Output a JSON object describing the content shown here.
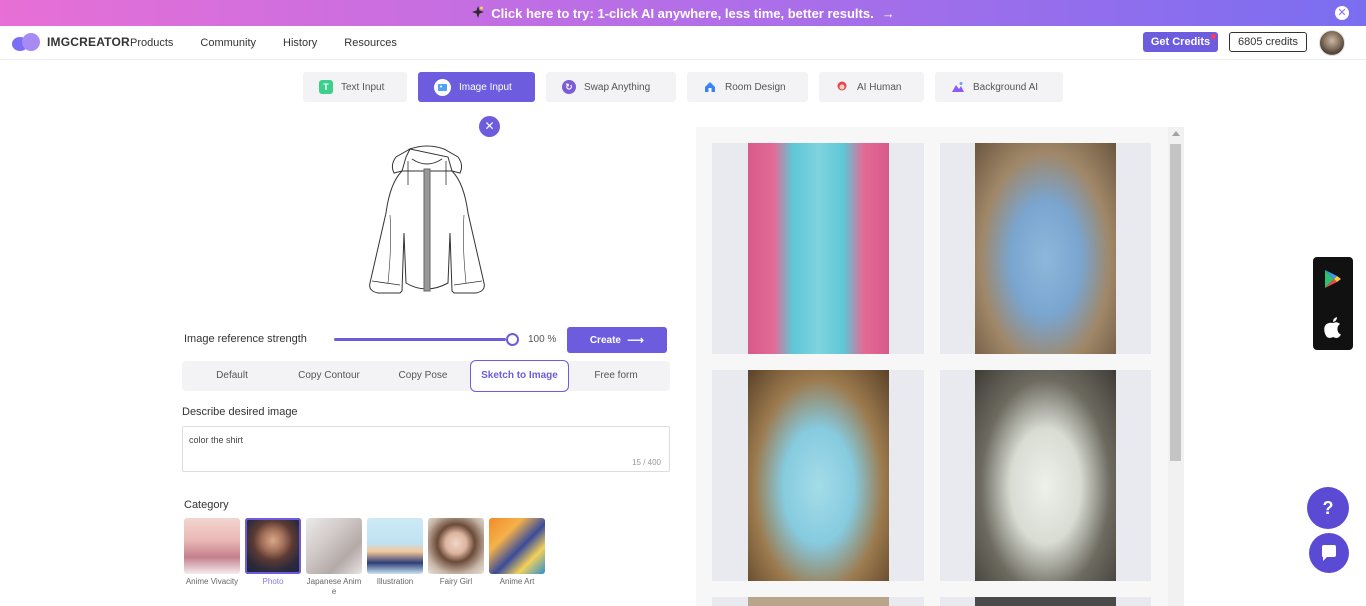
{
  "promo": {
    "text": "Click here to try: 1-click AI anywhere, less time, better results.",
    "arrow": "→",
    "close": "✕"
  },
  "nav": {
    "logo": "IMGCREATOR",
    "links": [
      "Products",
      "Community",
      "History",
      "Resources"
    ],
    "get_credits": "Get Credits",
    "credits_count": "6805 credits"
  },
  "tabs": [
    {
      "label": "Text Input",
      "icon": "text-icon",
      "color": "#3ecf8e"
    },
    {
      "label": "Image Input",
      "icon": "image-icon",
      "color": "#4fa3f7"
    },
    {
      "label": "Swap Anything",
      "icon": "swap-icon",
      "color": "#7b5cd6"
    },
    {
      "label": "Room Design",
      "icon": "house-icon",
      "color": "#3b82f6"
    },
    {
      "label": "AI Human",
      "icon": "human-icon",
      "color": "#e5484d"
    },
    {
      "label": "Background AI",
      "icon": "background-icon",
      "color": "#8b5cf6"
    }
  ],
  "editor": {
    "strength_label": "Image reference strength",
    "strength_value": "100 %",
    "strength_level": 1.0,
    "create_label": "Create",
    "modes": [
      "Default",
      "Copy Contour",
      "Copy Pose",
      "Sketch to Image",
      "Free form"
    ],
    "active_mode": "Sketch to Image",
    "describe_label": "Describe desired image",
    "describe_value": "color the shirt",
    "char_count": "15 / 400",
    "category_label": "Category",
    "categories": [
      "Anime Vivacity",
      "Photo",
      "Japanese Anime",
      "Illustration",
      "Fairy Girl",
      "Anime Art"
    ],
    "active_category": "Photo"
  },
  "help_label": "?"
}
